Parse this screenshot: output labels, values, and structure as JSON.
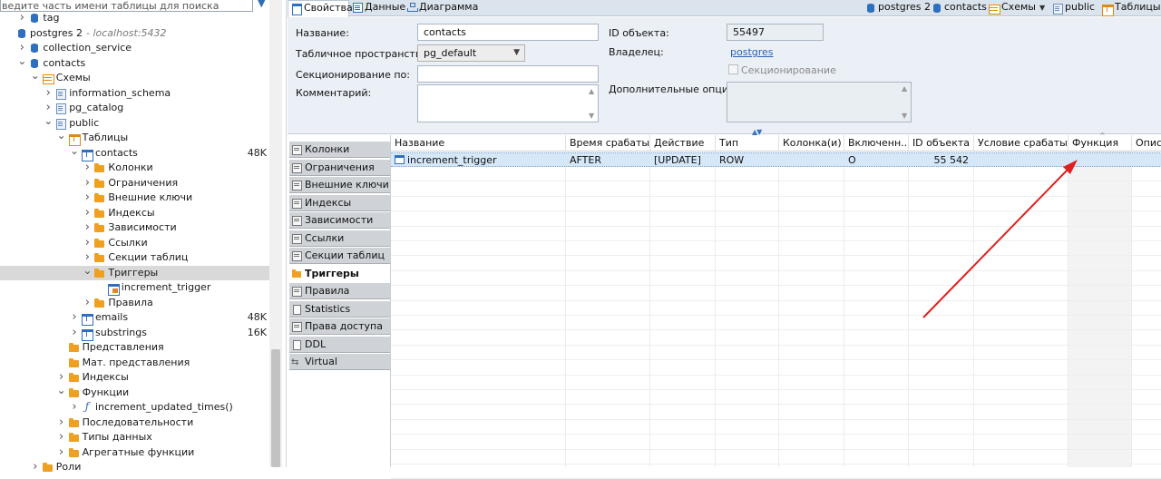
{
  "navigator": {
    "search_placeholder": "ведите часть имени таблицы для поиска",
    "tree": [
      {
        "depth": 1,
        "twisty": "closed",
        "icon": "tag-icon",
        "cls": "db",
        "label": "tag"
      },
      {
        "depth": 0,
        "twisty": "none",
        "icon": "postgres-connection-icon",
        "cls": "db",
        "label": "postgres 2",
        "sub": " - localhost:5432"
      },
      {
        "depth": 1,
        "twisty": "closed",
        "icon": "database-icon",
        "cls": "db",
        "label": "collection_service"
      },
      {
        "depth": 1,
        "twisty": "open",
        "icon": "database-icon",
        "cls": "db",
        "label": "contacts"
      },
      {
        "depth": 2,
        "twisty": "open",
        "icon": "schemas-folder-icon",
        "cls": "schemas",
        "label": "Схемы"
      },
      {
        "depth": 3,
        "twisty": "closed",
        "icon": "schema-icon",
        "cls": "schema",
        "label": "information_schema"
      },
      {
        "depth": 3,
        "twisty": "closed",
        "icon": "schema-icon",
        "cls": "schema",
        "label": "pg_catalog"
      },
      {
        "depth": 3,
        "twisty": "open",
        "icon": "schema-icon",
        "cls": "schema",
        "label": "public"
      },
      {
        "depth": 4,
        "twisty": "open",
        "icon": "tables-folder-icon",
        "cls": "tables",
        "label": "Таблицы"
      },
      {
        "depth": 5,
        "twisty": "open",
        "icon": "table-icon",
        "cls": "tbl",
        "label": "contacts",
        "size": "48K"
      },
      {
        "depth": 6,
        "twisty": "closed",
        "icon": "folder-icon",
        "cls": "folder",
        "label": "Колонки"
      },
      {
        "depth": 6,
        "twisty": "closed",
        "icon": "folder-icon",
        "cls": "folder",
        "label": "Ограничения"
      },
      {
        "depth": 6,
        "twisty": "closed",
        "icon": "folder-icon",
        "cls": "folder",
        "label": "Внешние ключи"
      },
      {
        "depth": 6,
        "twisty": "closed",
        "icon": "folder-icon",
        "cls": "folder",
        "label": "Индексы"
      },
      {
        "depth": 6,
        "twisty": "closed",
        "icon": "folder-icon",
        "cls": "folder",
        "label": "Зависимости"
      },
      {
        "depth": 6,
        "twisty": "closed",
        "icon": "folder-icon",
        "cls": "folder",
        "label": "Ссылки"
      },
      {
        "depth": 6,
        "twisty": "closed",
        "icon": "folder-icon",
        "cls": "folder",
        "label": "Секции таблиц"
      },
      {
        "depth": 6,
        "twisty": "open",
        "icon": "folder-icon",
        "cls": "folder",
        "label": "Триггеры",
        "selected": true
      },
      {
        "depth": 7,
        "twisty": "none",
        "icon": "trigger-icon",
        "cls": "trig",
        "label": "increment_trigger"
      },
      {
        "depth": 6,
        "twisty": "closed",
        "icon": "folder-icon",
        "cls": "folder",
        "label": "Правила"
      },
      {
        "depth": 5,
        "twisty": "closed",
        "icon": "table-icon",
        "cls": "tbl",
        "label": "emails",
        "size": "48K"
      },
      {
        "depth": 5,
        "twisty": "closed",
        "icon": "table-icon",
        "cls": "tbl",
        "label": "substrings",
        "size": "16K"
      },
      {
        "depth": 4,
        "twisty": "none",
        "icon": "folder-icon",
        "cls": "folder",
        "label": "Представления"
      },
      {
        "depth": 4,
        "twisty": "none",
        "icon": "folder-icon",
        "cls": "folder",
        "label": "Мат. представления"
      },
      {
        "depth": 4,
        "twisty": "closed",
        "icon": "folder-icon",
        "cls": "folder",
        "label": "Индексы"
      },
      {
        "depth": 4,
        "twisty": "open",
        "icon": "folder-icon",
        "cls": "folder",
        "label": "Функции"
      },
      {
        "depth": 5,
        "twisty": "closed",
        "icon": "function-icon",
        "cls": "func",
        "label": "increment_updated_times()"
      },
      {
        "depth": 4,
        "twisty": "closed",
        "icon": "folder-icon",
        "cls": "folder",
        "label": "Последовательности"
      },
      {
        "depth": 4,
        "twisty": "closed",
        "icon": "folder-icon",
        "cls": "folder",
        "label": "Типы данных"
      },
      {
        "depth": 4,
        "twisty": "closed",
        "icon": "folder-icon",
        "cls": "folder",
        "label": "Агрегатные функции"
      },
      {
        "depth": 2,
        "twisty": "closed",
        "icon": "folder-icon",
        "cls": "folder",
        "label": "Роли"
      }
    ]
  },
  "editor": {
    "tabs": [
      {
        "label": "Свойства",
        "icon": "properties-icon",
        "active": true
      },
      {
        "label": "Данные",
        "icon": "data-icon",
        "active": false
      },
      {
        "label": "Диаграмма",
        "icon": "diagram-icon",
        "active": false
      }
    ],
    "breadcrumbs": [
      {
        "label": "postgres 2",
        "icon": "postgres-connection-icon",
        "dropdown": false
      },
      {
        "label": "contacts",
        "icon": "database-icon",
        "dropdown": false
      },
      {
        "label": "Схемы",
        "icon": "schemas-folder-icon",
        "dropdown": true
      },
      {
        "label": "public",
        "icon": "schema-icon",
        "dropdown": false
      },
      {
        "label": "Таблицы",
        "icon": "tables-folder-icon",
        "dropdown": false
      }
    ]
  },
  "properties": {
    "name_label": "Название:",
    "name_value": "contacts",
    "tablespace_label": "Табличное пространство:",
    "tablespace_value": "pg_default",
    "partition_label": "Секционирование по:",
    "partition_value": "",
    "comment_label": "Комментарий:",
    "comment_value": "",
    "object_id_label": "ID объекта:",
    "object_id_value": "55497",
    "owner_label": "Владелец:",
    "owner_value": "postgres",
    "partitioning_checkbox_label": "Секционирование",
    "extra_options_label": "Дополнительные опции:",
    "extra_options_value": ""
  },
  "side_tabs": [
    {
      "label": "Колонки",
      "icon": "columns-icon",
      "cls": "grid"
    },
    {
      "label": "Ограничения",
      "icon": "constraints-icon",
      "cls": "grid"
    },
    {
      "label": "Внешние ключи",
      "icon": "foreign-keys-icon",
      "cls": "grid"
    },
    {
      "label": "Индексы",
      "icon": "indexes-icon",
      "cls": "grid"
    },
    {
      "label": "Зависимости",
      "icon": "dependencies-icon",
      "cls": "grid"
    },
    {
      "label": "Ссылки",
      "icon": "references-icon",
      "cls": "grid"
    },
    {
      "label": "Секции таблиц",
      "icon": "partitions-icon",
      "cls": "grid"
    },
    {
      "label": "Триггеры",
      "icon": "triggers-icon",
      "cls": "fold",
      "active": true
    },
    {
      "label": "Правила",
      "icon": "rules-icon",
      "cls": "grid"
    },
    {
      "label": "Statistics",
      "icon": "statistics-icon",
      "cls": "doc"
    },
    {
      "label": "Права доступа",
      "icon": "permissions-icon",
      "cls": "grid"
    },
    {
      "label": "DDL",
      "icon": "ddl-icon",
      "cls": "doc"
    },
    {
      "label": "Virtual",
      "icon": "virtual-icon",
      "cls": "link"
    }
  ],
  "triggers_grid": {
    "columns": [
      "Название",
      "Время срабаты...",
      "Действие",
      "Тип",
      "Колонка(и)",
      "Включенн...",
      "ID объекта",
      "Условие срабаты...",
      "Функция",
      "Описа"
    ],
    "rows": [
      [
        "increment_trigger",
        "AFTER",
        "[UPDATE]",
        "ROW",
        "",
        "O",
        "55 542",
        "",
        "",
        ""
      ]
    ]
  },
  "colors": {
    "accent": "#2f6fbf",
    "folder": "#f0a020",
    "annotation_arrow": "#e02020"
  }
}
